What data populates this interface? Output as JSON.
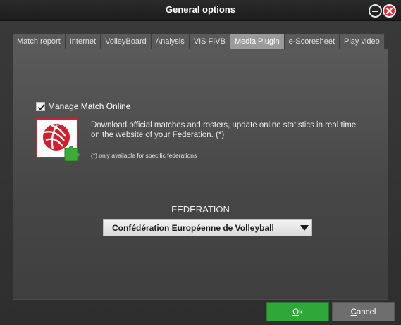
{
  "window": {
    "title": "General options"
  },
  "tabs": [
    {
      "label": "Match report",
      "active": false
    },
    {
      "label": "Internet",
      "active": false
    },
    {
      "label": "VolleyBoard",
      "active": false
    },
    {
      "label": "Analysis",
      "active": false
    },
    {
      "label": "VIS FIVB",
      "active": false
    },
    {
      "label": "Media Plugin",
      "active": true
    },
    {
      "label": "e-Scoresheet",
      "active": false
    },
    {
      "label": "Play video",
      "active": false
    }
  ],
  "manage_online": {
    "label": "Manage Match Online",
    "checked": true,
    "description": "Download official matches and rosters, update online statistics in real time on the website of your Federation. (*)",
    "note": "(*) only available for specific federations",
    "icon": "volleyball-puzzle-icon"
  },
  "federation": {
    "label": "FEDERATION",
    "selected": "Confédération Européenne de Volleyball"
  },
  "buttons": {
    "ok_mnemonic": "O",
    "ok_rest": "k",
    "cancel_mnemonic": "C",
    "cancel_rest": "ancel"
  },
  "colors": {
    "ok": "#2fa83a",
    "close": "#e0283a",
    "active_tab": "#9a9a9a"
  }
}
